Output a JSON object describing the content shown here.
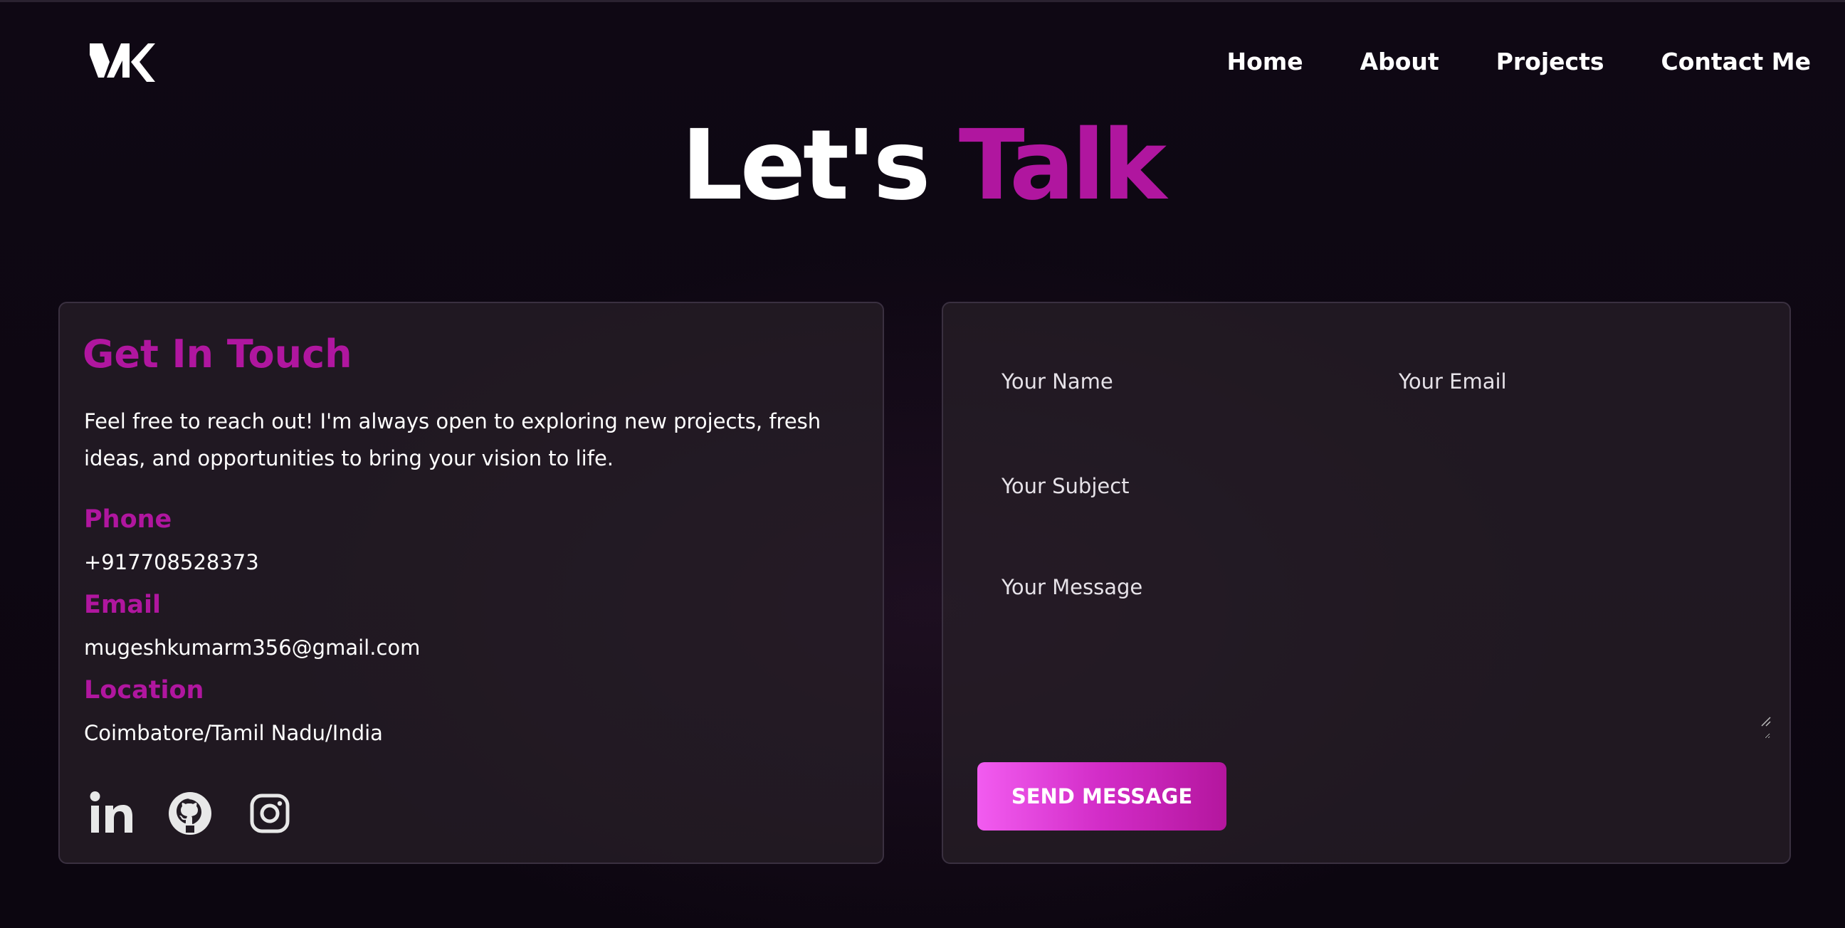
{
  "header": {
    "logo_text": "MK",
    "nav": [
      "Home",
      "About",
      "Projects",
      "Contact Me"
    ]
  },
  "title": {
    "part1": "Let's",
    "part2": "Talk"
  },
  "contact": {
    "heading": "Get In Touch",
    "intro": "Feel free to reach out! I'm always open to exploring new projects, fresh ideas, and opportunities to bring your vision to life.",
    "phone_label": "Phone",
    "phone": "+917708528373",
    "email_label": "Email",
    "email": "mugeshkumarm356@gmail.com",
    "location_label": "Location",
    "location": "Coimbatore/Tamil Nadu/India",
    "socials": [
      "linkedin-icon",
      "github-icon",
      "instagram-icon"
    ]
  },
  "form": {
    "name_placeholder": "Your Name",
    "email_placeholder": "Your Email",
    "subject_placeholder": "Your Subject",
    "message_placeholder": "Your Message",
    "submit_label": "SEND MESSAGE"
  },
  "colors": {
    "accent": "#b0169f",
    "background": "#0e0713",
    "card": "#282028",
    "button_start": "#f25cf0",
    "button_end": "#b4169e"
  }
}
